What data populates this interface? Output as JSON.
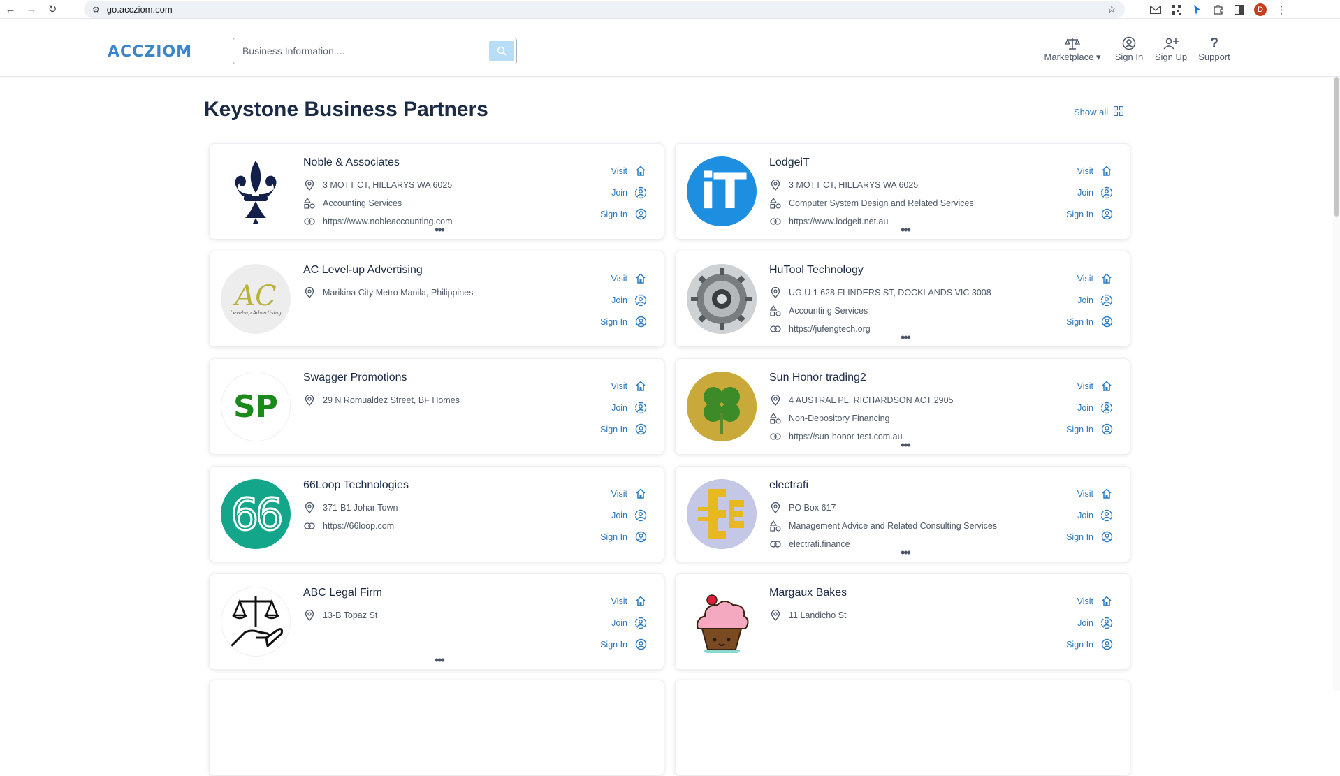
{
  "browser": {
    "url": "go.accziom.com",
    "avatar_letter": "D"
  },
  "header": {
    "logo_text": "ACCZIOM",
    "search_placeholder": "Business Information ...",
    "nav": {
      "marketplace": "Marketplace",
      "sign_in": "Sign In",
      "sign_up": "Sign Up",
      "support": "Support"
    }
  },
  "main": {
    "title": "Keystone Business Partners",
    "show_all": "Show all",
    "actions": {
      "visit": "Visit",
      "join": "Join",
      "sign_in": "Sign In"
    },
    "partners": [
      {
        "name": "Noble & Associates",
        "address": "3 MOTT CT, HILLARYS WA 6025",
        "category": "Accounting Services",
        "website": "https://www.nobleaccounting.com",
        "logo": "fleur-de-lis"
      },
      {
        "name": "LodgeiT",
        "address": "3 MOTT CT, HILLARYS WA 6025",
        "category": "Computer System Design and Related Services",
        "website": "https://www.lodgeit.net.au",
        "logo_text": "iT"
      },
      {
        "name": "AC Level-up Advertising",
        "address": "Marikina City Metro Manila, Philippines",
        "logo_text": "AC",
        "logo_subtext": "Level-up Advertising"
      },
      {
        "name": "HuTool Technology",
        "address": "UG U 1 628 FLINDERS ST, DOCKLANDS VIC 3008",
        "category": "Accounting Services",
        "website": "https://jufengtech.org",
        "logo": "gear"
      },
      {
        "name": "Swagger Promotions",
        "address": "29 N Romualdez Street, BF Homes",
        "logo_text": "SP"
      },
      {
        "name": "Sun Honor trading2",
        "address": "4 AUSTRAL PL, RICHARDSON ACT 2905",
        "category": "Non-Depository Financing",
        "website": "https://sun-honor-test.com.au",
        "logo": "clover"
      },
      {
        "name": "66Loop Technologies",
        "address": "371-B1 Johar Town",
        "website": "https://66loop.com",
        "logo_text": "66"
      },
      {
        "name": "electrafi",
        "address": "PO Box 617",
        "category": "Management Advice and Related Consulting Services",
        "website": "electrafi.finance",
        "logo": "electrafi-mark"
      },
      {
        "name": "ABC Legal Firm",
        "address": "13-B Topaz St",
        "logo": "scales-hand"
      },
      {
        "name": "Margaux Bakes",
        "address": "11 Landicho St",
        "logo": "cupcake"
      }
    ]
  },
  "colors": {
    "accent": "#2a7ac0",
    "logo_blue": "#3a86c9",
    "text_dark": "#1c2b45",
    "swagger_green": "#1a8a1a",
    "loop_teal": "#14a68a",
    "lodgeit_blue": "#1e8fe0"
  }
}
